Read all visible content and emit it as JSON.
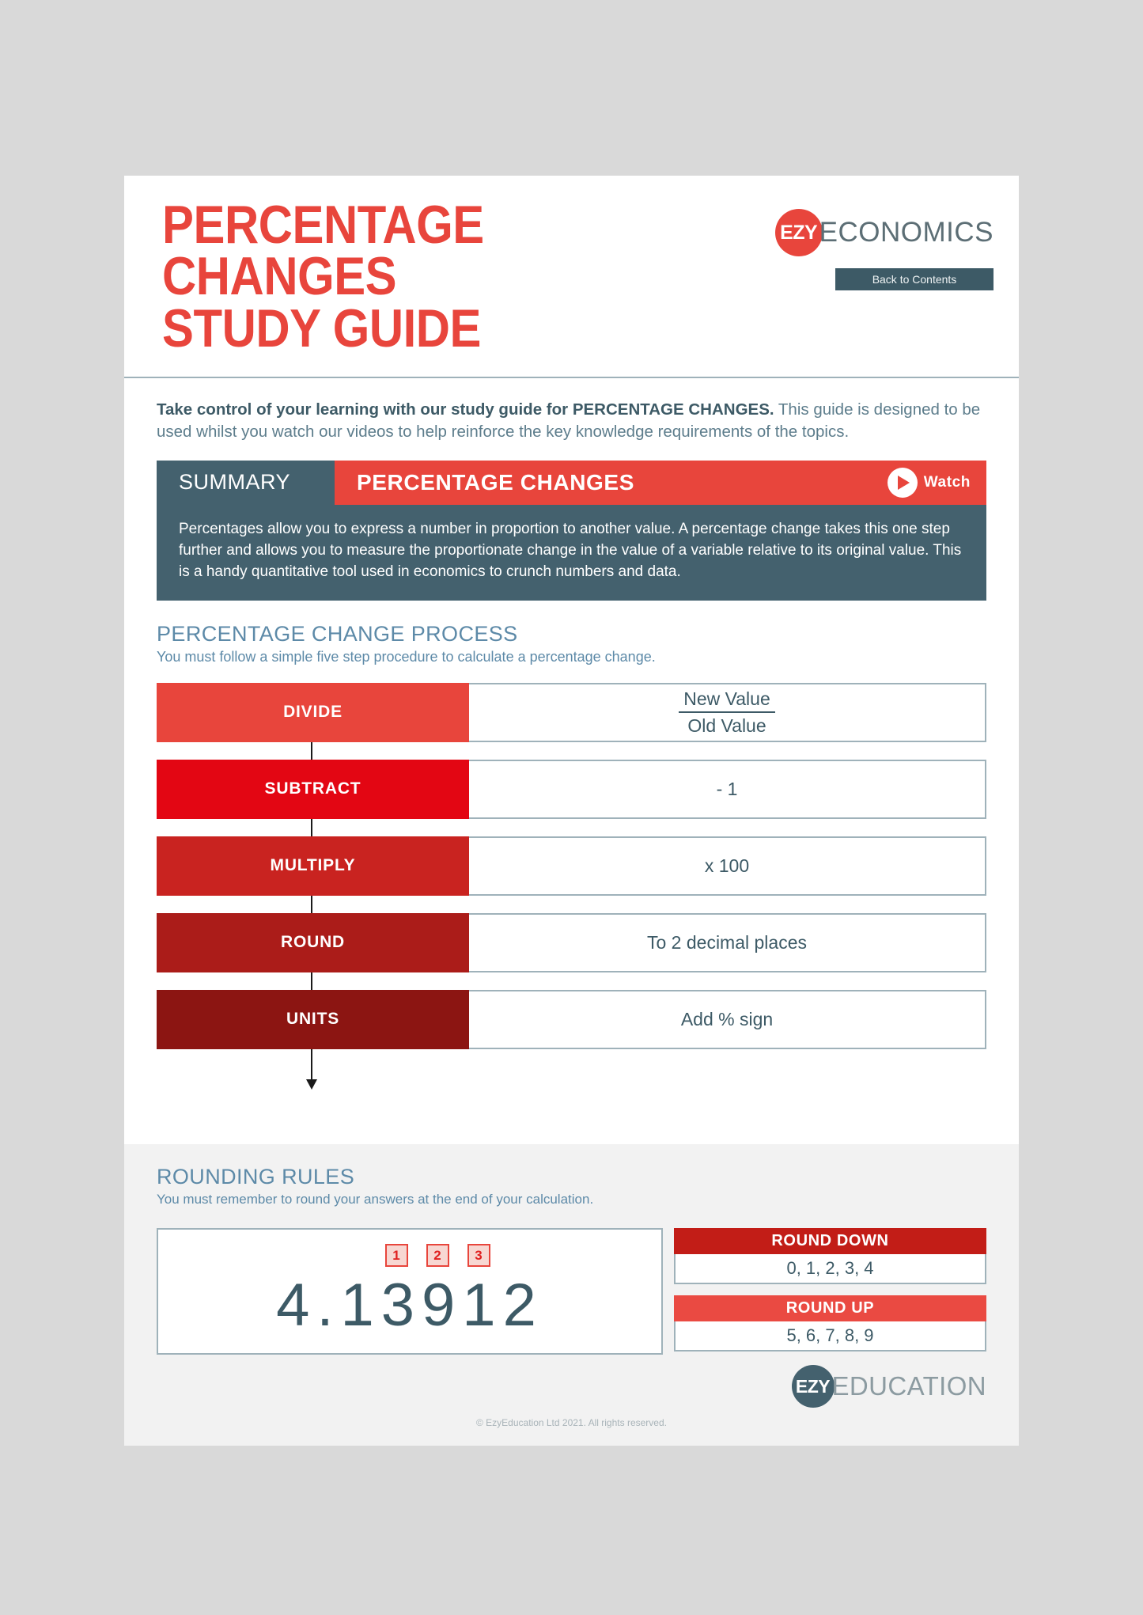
{
  "colors": {
    "brand_red": "#e8453c",
    "teal": "#44616e",
    "heading_blue": "#5d8aa8",
    "body_blue": "#5d7d8c",
    "border_gray": "#9fb2ba",
    "band_gray": "#f2f2f2"
  },
  "header": {
    "title": "PERCENTAGE\nCHANGES\nSTUDY GUIDE",
    "brand_mark": "EZY",
    "brand_word": "ECONOMICS",
    "back_button": "Back to Contents"
  },
  "intro": {
    "bold": "Take control of your learning with our study guide for PERCENTAGE CHANGES.",
    "rest": " This guide is designed to be used whilst you watch our videos to help reinforce the key knowledge requirements of the topics."
  },
  "summary": {
    "tab_label": "SUMMARY",
    "topic": "PERCENTAGE CHANGES",
    "watch_label": "Watch",
    "body": "Percentages allow you to express a number in proportion to another value. A percentage change takes this one step further and allows you to measure the proportionate change in the value of a variable relative to its original value. This is a handy quantitative tool used in economics to crunch numbers and data."
  },
  "process": {
    "heading": "PERCENTAGE CHANGE PROCESS",
    "subheading": "You must follow a simple five step procedure to calculate a percentage change.",
    "steps": [
      {
        "label": "DIVIDE",
        "value": "",
        "fraction_top": "New Value",
        "fraction_bottom": "Old Value",
        "color": "#e8453c"
      },
      {
        "label": "SUBTRACT",
        "value": "- 1",
        "color": "#e30613"
      },
      {
        "label": "MULTIPLY",
        "value": "x 100",
        "color": "#c92320"
      },
      {
        "label": "ROUND",
        "value": "To 2 decimal places",
        "color": "#ab1c19"
      },
      {
        "label": "UNITS",
        "value": "Add % sign",
        "color": "#8c1512"
      }
    ]
  },
  "rounding": {
    "heading": "ROUNDING RULES",
    "subheading": "You must remember to round your answers at the end of your calculation.",
    "number": "4.13912",
    "markers": [
      "1",
      "2",
      "3"
    ],
    "rules": [
      {
        "title": "ROUND DOWN",
        "values": "0, 1, 2, 3, 4",
        "color": "#c21d17"
      },
      {
        "title": "ROUND UP",
        "values": "5, 6, 7, 8, 9",
        "color": "#ea4a42"
      }
    ]
  },
  "footer": {
    "brand_mark": "EZY",
    "brand_word": "EDUCATION",
    "copyright": "© EzyEducation Ltd 2021. All rights reserved."
  }
}
